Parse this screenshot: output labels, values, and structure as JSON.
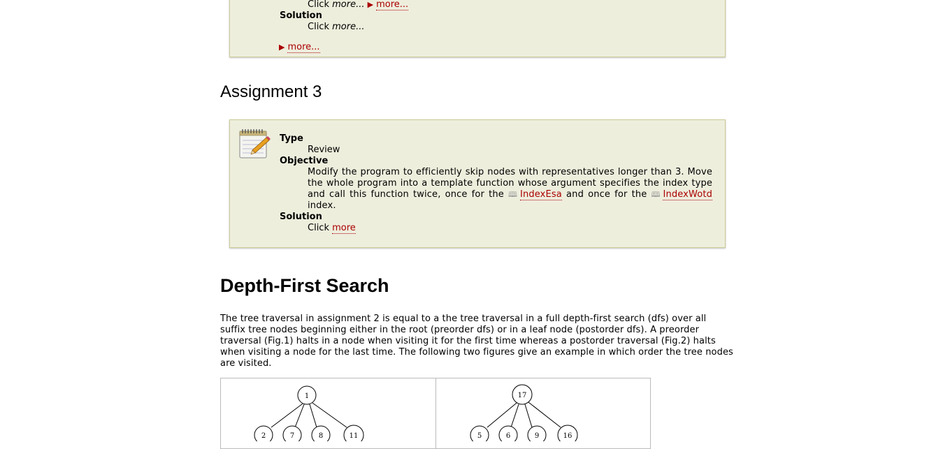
{
  "box1": {
    "line1_text": "Click ",
    "line1_em": "more...",
    "line1_more": "more...",
    "solution_label": "Solution",
    "solution_text": "Click ",
    "solution_em": "more...",
    "footer_more": "more..."
  },
  "assignment3": {
    "heading": "Assignment 3",
    "type_label": "Type",
    "type_value": "Review",
    "objective_label": "Objective",
    "objective_part1": "Modify the program to efficiently skip nodes with representatives longer than 3. Move the whole program into a template function whose argument specifies the index type and call this function twice, once for the ",
    "link_index_esa": "IndexEsa",
    "objective_part2": " and once for the ",
    "link_index_wotd": "IndexWotd",
    "objective_part3": " index.",
    "solution_label": "Solution",
    "solution_text": "Click ",
    "solution_link": "more"
  },
  "dfs": {
    "heading": "Depth-First Search",
    "paragraph": "The tree traversal in assignment 2 is equal to a the tree traversal in a full depth-first search (dfs) over all suffix tree nodes beginning either in the root (preorder dfs) or in a leaf node (postorder dfs). A preorder traversal (Fig.1) halts in a node when visiting it for the first time whereas a postorder traversal (Fig.2) halts when visiting a node for the last time. The following two figures give an example in which order the tree nodes are visited."
  },
  "figures": {
    "fig1": {
      "root": "1",
      "children": [
        "2",
        "7",
        "8",
        "11"
      ]
    },
    "fig2": {
      "root": "17",
      "children": [
        "5",
        "6",
        "9",
        "16"
      ]
    }
  }
}
